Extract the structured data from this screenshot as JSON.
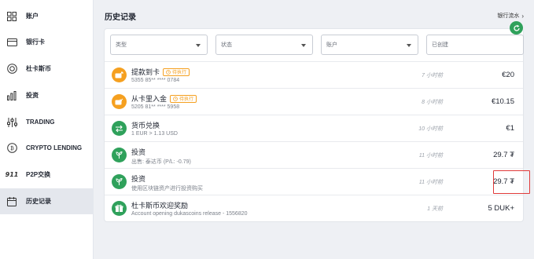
{
  "sidebar": {
    "items": [
      {
        "label": "账户",
        "icon": "grid-icon"
      },
      {
        "label": "银行卡",
        "icon": "card-icon"
      },
      {
        "label": "杜卡斯币",
        "icon": "coin-icon"
      },
      {
        "label": "投资",
        "icon": "bar-chart-icon"
      },
      {
        "label": "TRADING",
        "icon": "sliders-icon"
      },
      {
        "label": "CRYPTO LENDING",
        "icon": "lending-icon"
      },
      {
        "label": "P2P交换",
        "icon": "p2p-icon",
        "icon_text": "911"
      },
      {
        "label": "历史记录",
        "icon": "calendar-icon",
        "active": true
      }
    ]
  },
  "header": {
    "title": "历史记录",
    "bank_statement_link": "银行流水",
    "bank_statement_chevron": "›"
  },
  "filters": {
    "type": "类型",
    "status": "状态",
    "account": "账户",
    "created": "已创建"
  },
  "transactions": [
    {
      "title": "提款到卡",
      "badge": "待执行",
      "sub": "5355 85** **** 0784",
      "time": "7 小时前",
      "amount": "€20",
      "icon": "card-out-icon",
      "color": "orange"
    },
    {
      "title": "从卡里入金",
      "badge": "待执行",
      "sub": "5205 81** **** 5958",
      "time": "8 小时前",
      "amount": "€10.15",
      "icon": "card-in-icon",
      "color": "orange"
    },
    {
      "title": "货币兑换",
      "badge": "",
      "sub": "1 EUR > 1.13 USD",
      "time": "10 小时前",
      "amount": "€1",
      "icon": "exchange-icon",
      "color": "green"
    },
    {
      "title": "投资",
      "badge": "",
      "sub": "出售: 泰达币 (P/L: -0.79)",
      "time": "11 小时前",
      "amount": "29.7 ₮",
      "icon": "invest-icon",
      "color": "green"
    },
    {
      "title": "投资",
      "badge": "",
      "sub": "使用区块链资产进行投资购买",
      "time": "11 小时前",
      "amount": "29.7 ₮",
      "icon": "invest-icon",
      "color": "green"
    },
    {
      "title": "杜卡斯币欢迎奖励",
      "badge": "",
      "sub": "Account opening dukascoins release - 1556820",
      "time": "1 天前",
      "amount": "5 DUK+",
      "icon": "reward-icon",
      "color": "green"
    }
  ],
  "colors": {
    "accent_green": "#2fa15b",
    "pending_orange": "#f5a020",
    "highlight_red": "#e03a3a"
  }
}
